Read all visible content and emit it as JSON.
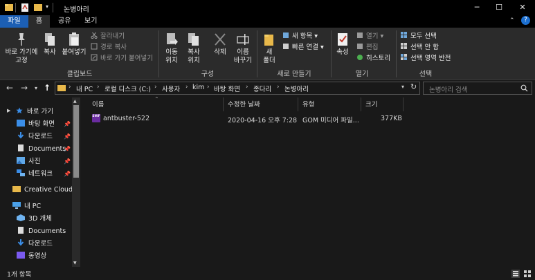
{
  "window": {
    "title": "논병아리",
    "minimize": "─",
    "maximize": "☐",
    "close": "✕"
  },
  "tabs": {
    "file": "파일",
    "home": "홈",
    "share": "공유",
    "view": "보기"
  },
  "ribbon": {
    "clipboard": {
      "group_label": "클립보드",
      "pin_quick_access": [
        "바로 가기에",
        "고정"
      ],
      "copy": "복사",
      "paste": "붙여넣기",
      "cut": "잘라내기",
      "copy_path": "경로 복사",
      "paste_shortcut": "바로 가기 붙여넣기"
    },
    "organize": {
      "group_label": "구성",
      "move_to": [
        "이동",
        "위치"
      ],
      "copy_to": [
        "복사",
        "위치"
      ],
      "delete": "삭제",
      "rename": [
        "이름",
        "바꾸기"
      ]
    },
    "new": {
      "group_label": "새로 만들기",
      "new_folder": [
        "새",
        "폴더"
      ],
      "new_item": "새 항목",
      "easy_access": "빠른 연결"
    },
    "open": {
      "group_label": "열기",
      "properties": "속성",
      "open": "열기",
      "edit": "편집",
      "history": "히스토리"
    },
    "select": {
      "group_label": "선택",
      "select_all": "모두 선택",
      "select_none": "선택 안 함",
      "invert": "선택 영역 반전"
    }
  },
  "address": {
    "crumbs": [
      "내 PC",
      "로컬 디스크 (C:)",
      "사용자",
      "kim",
      "바탕 화면",
      "종다리",
      "논병아리"
    ],
    "search_placeholder": "논병아리 검색"
  },
  "nav_pane": {
    "quick_access": "바로 가기",
    "items": [
      {
        "label": "바탕 화면",
        "icon": "desktop-icon",
        "pinned": true
      },
      {
        "label": "다운로드",
        "icon": "download-icon",
        "pinned": true
      },
      {
        "label": "Documents",
        "icon": "document-icon",
        "pinned": true
      },
      {
        "label": "사진",
        "icon": "pictures-icon",
        "pinned": true
      },
      {
        "label": "네트워크",
        "icon": "network-icon",
        "pinned": true
      }
    ],
    "creative_cloud": "Creative Cloud Fi",
    "this_pc": "내 PC",
    "pc_items": [
      {
        "label": "3D 개체",
        "icon": "3d-objects-icon"
      },
      {
        "label": "Documents",
        "icon": "document-icon"
      },
      {
        "label": "다운로드",
        "icon": "download-icon"
      },
      {
        "label": "동영상",
        "icon": "video-icon"
      }
    ]
  },
  "columns": {
    "name": "이름",
    "modified": "수정한 날짜",
    "type": "유형",
    "size": "크기"
  },
  "files": [
    {
      "name": "antbuster-522",
      "modified": "2020-04-16 오후 7:28",
      "type": "GOM 미디어 파일...",
      "size": "377KB",
      "icon_text": "SWF"
    }
  ],
  "status": {
    "item_count": "1개 항목"
  },
  "colors": {
    "accent": "#1c5fb4",
    "background": "#191919",
    "ribbon": "#2b2b2b"
  }
}
